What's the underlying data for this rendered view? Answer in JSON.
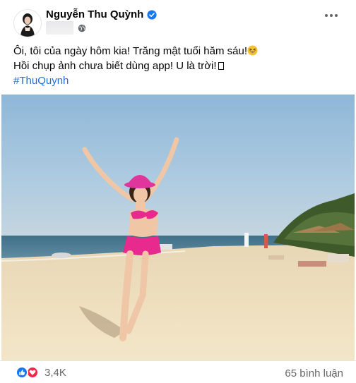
{
  "post": {
    "author": "Nguyễn Thu Quỳnh",
    "verified_icon": "verified-badge-icon",
    "privacy_icon": "globe-icon",
    "more_icon": "more-options-icon",
    "text_line1": "Ôi, tôi của ngày hôm kia! Trăng mật tuổi hăm sáu!",
    "text_line2": "Hồi chụp ảnh chưa biết dùng app! U là trời!",
    "hashtag": "#ThuQuynh",
    "emoji_icon": "grinning-squinting-face-icon"
  },
  "photo": {
    "description_icon": "beach-photo"
  },
  "footer": {
    "reaction_count": "3,4K",
    "comment_count": "65 bình luận",
    "reaction_icons": [
      "like-icon",
      "love-icon"
    ]
  },
  "colors": {
    "accent": "#1877f2",
    "hashtag": "#216fdb",
    "love": "#f0284a",
    "secondary_text": "#65676b"
  }
}
